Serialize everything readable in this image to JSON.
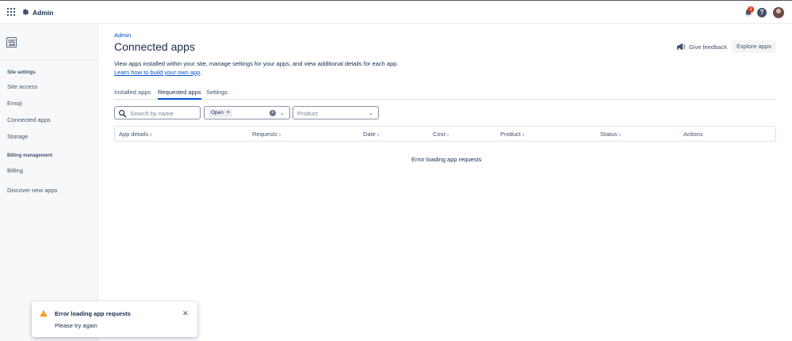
{
  "topbar": {
    "app_title": "Admin",
    "notification_count": "1"
  },
  "sidebar": {
    "sections": [
      {
        "title": "Site settings",
        "items": [
          "Site access",
          "Emoji",
          "Connected apps",
          "Storage"
        ]
      },
      {
        "title": "Billing management",
        "items": [
          "Billing"
        ]
      }
    ],
    "footer_item": "Discover new apps"
  },
  "main": {
    "breadcrumb": "Admin",
    "title": "Connected apps",
    "description": "View apps installed within your site, manage settings for your apps, and view additional details for each app.",
    "learn_link": "Learn how to build your own app",
    "learn_suffix": ".",
    "feedback_label": "Give feedback",
    "explore_label": "Explore apps",
    "tabs": [
      "Installed apps",
      "Requested apps",
      "Settings"
    ],
    "active_tab": "Requested apps",
    "filters": {
      "search_placeholder": "Search by name",
      "status_chip": "Open",
      "product_placeholder": "Product"
    },
    "columns": [
      "App details",
      "Requests",
      "Date",
      "Cost",
      "Product",
      "Status",
      "Actions"
    ],
    "empty_message": "Error loading app requests"
  },
  "toast": {
    "title": "Error loading app requests",
    "message": "Please try again"
  },
  "colors": {
    "link": "#0052cc",
    "text": "#172b4d",
    "warning": "#ff8b00",
    "badge": "#de350b"
  }
}
